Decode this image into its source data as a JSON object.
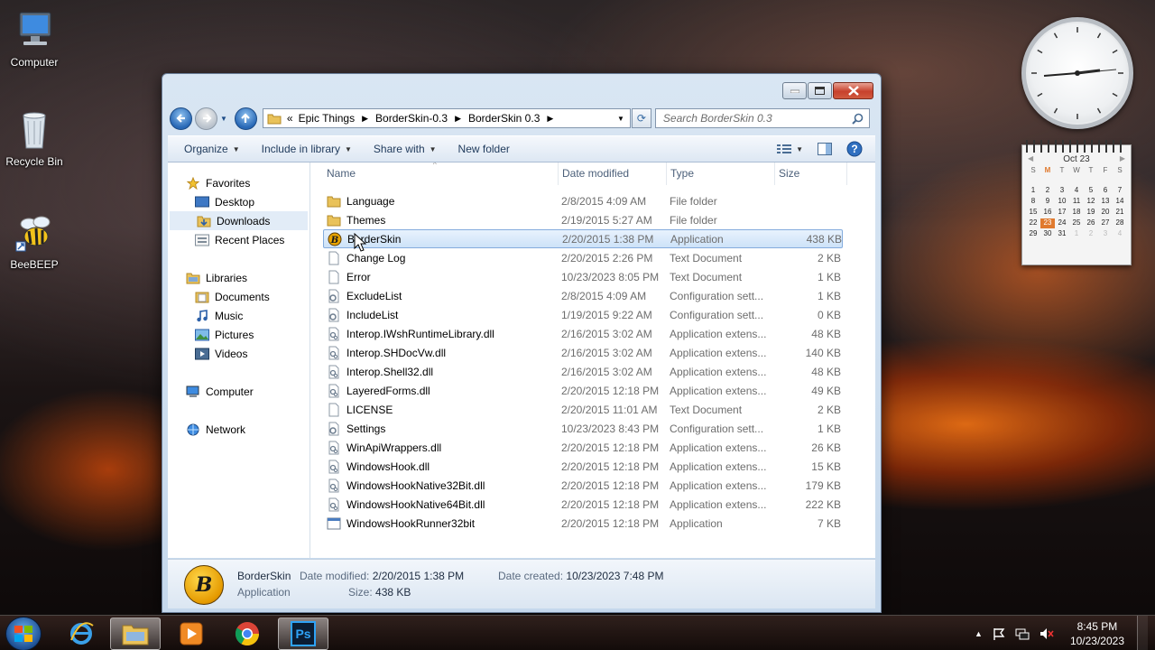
{
  "desktop": {
    "icons": [
      {
        "label": "Computer"
      },
      {
        "label": "Recycle Bin"
      },
      {
        "label": "BeeBEEP"
      }
    ]
  },
  "calendar": {
    "month": "Oct 23",
    "prev": "◀",
    "next": "▶",
    "day_headers": [
      "S",
      "M",
      "T",
      "W",
      "T",
      "F",
      "S"
    ],
    "days": [
      "",
      "",
      "",
      "",
      "",
      "",
      "",
      "1",
      "2",
      "3",
      "4",
      "5",
      "6",
      "7",
      "8",
      "9",
      "10",
      "11",
      "12",
      "13",
      "14",
      "15",
      "16",
      "17",
      "18",
      "19",
      "20",
      "21",
      "22",
      "23",
      "24",
      "25",
      "26",
      "27",
      "28",
      "29",
      "30",
      "31",
      "1",
      "2",
      "3",
      "4"
    ],
    "today": "23"
  },
  "window": {
    "nav": {
      "path": [
        "Epic Things",
        "BorderSkin-0.3",
        "BorderSkin 0.3"
      ],
      "overflow": "«",
      "search_placeholder": "Search BorderSkin 0.3"
    },
    "toolbar": {
      "organize": "Organize",
      "include_in_library": "Include in library",
      "share_with": "Share with",
      "new_folder": "New folder"
    },
    "navpane": {
      "favorites": "Favorites",
      "desktop": "Desktop",
      "downloads": "Downloads",
      "recent_places": "Recent Places",
      "libraries": "Libraries",
      "documents": "Documents",
      "music": "Music",
      "pictures": "Pictures",
      "videos": "Videos",
      "computer": "Computer",
      "network": "Network"
    },
    "columns": {
      "name": "Name",
      "date": "Date modified",
      "type": "Type",
      "size": "Size"
    },
    "files": [
      {
        "name": "Language",
        "date": "2/8/2015 4:09 AM",
        "type": "File folder",
        "size": "",
        "icon": "folder"
      },
      {
        "name": "Themes",
        "date": "2/19/2015 5:27 AM",
        "type": "File folder",
        "size": "",
        "icon": "folder"
      },
      {
        "name": "BorderSkin",
        "date": "2/20/2015 1:38 PM",
        "type": "Application",
        "size": "438 KB",
        "icon": "app-borderskin"
      },
      {
        "name": "Change Log",
        "date": "2/20/2015 2:26 PM",
        "type": "Text Document",
        "size": "2 KB",
        "icon": "text"
      },
      {
        "name": "Error",
        "date": "10/23/2023 8:05 PM",
        "type": "Text Document",
        "size": "1 KB",
        "icon": "text"
      },
      {
        "name": "ExcludeList",
        "date": "2/8/2015 4:09 AM",
        "type": "Configuration sett...",
        "size": "1 KB",
        "icon": "config"
      },
      {
        "name": "IncludeList",
        "date": "1/19/2015 9:22 AM",
        "type": "Configuration sett...",
        "size": "0 KB",
        "icon": "config"
      },
      {
        "name": "Interop.IWshRuntimeLibrary.dll",
        "date": "2/16/2015 3:02 AM",
        "type": "Application extens...",
        "size": "48 KB",
        "icon": "dll"
      },
      {
        "name": "Interop.SHDocVw.dll",
        "date": "2/16/2015 3:02 AM",
        "type": "Application extens...",
        "size": "140 KB",
        "icon": "dll"
      },
      {
        "name": "Interop.Shell32.dll",
        "date": "2/16/2015 3:02 AM",
        "type": "Application extens...",
        "size": "48 KB",
        "icon": "dll"
      },
      {
        "name": "LayeredForms.dll",
        "date": "2/20/2015 12:18 PM",
        "type": "Application extens...",
        "size": "49 KB",
        "icon": "dll"
      },
      {
        "name": "LICENSE",
        "date": "2/20/2015 11:01 AM",
        "type": "Text Document",
        "size": "2 KB",
        "icon": "text"
      },
      {
        "name": "Settings",
        "date": "10/23/2023 8:43 PM",
        "type": "Configuration sett...",
        "size": "1 KB",
        "icon": "config"
      },
      {
        "name": "WinApiWrappers.dll",
        "date": "2/20/2015 12:18 PM",
        "type": "Application extens...",
        "size": "26 KB",
        "icon": "dll"
      },
      {
        "name": "WindowsHook.dll",
        "date": "2/20/2015 12:18 PM",
        "type": "Application extens...",
        "size": "15 KB",
        "icon": "dll"
      },
      {
        "name": "WindowsHookNative32Bit.dll",
        "date": "2/20/2015 12:18 PM",
        "type": "Application extens...",
        "size": "179 KB",
        "icon": "dll"
      },
      {
        "name": "WindowsHookNative64Bit.dll",
        "date": "2/20/2015 12:18 PM",
        "type": "Application extens...",
        "size": "222 KB",
        "icon": "dll"
      },
      {
        "name": "WindowsHookRunner32bit",
        "date": "2/20/2015 12:18 PM",
        "type": "Application",
        "size": "7 KB",
        "icon": "app-generic"
      }
    ],
    "selected_index": 2,
    "details": {
      "logo_letter": "B",
      "name": "BorderSkin",
      "type": "Application",
      "date_modified_label": "Date modified:",
      "date_modified": "2/20/2015 1:38 PM",
      "size_label": "Size:",
      "size": "438 KB",
      "date_created_label": "Date created:",
      "date_created": "10/23/2023 7:48 PM"
    }
  },
  "taskbar": {
    "time": "8:45 PM",
    "date": "10/23/2023",
    "apps": [
      "internet-explorer",
      "windows-explorer",
      "media-player",
      "chrome",
      "photoshop"
    ],
    "photoshop_label": "Ps"
  },
  "colors": {
    "selection": "#cde2f8",
    "close_button": "#c8412c",
    "link_text": "#1e395b",
    "calendar_today": "#e07a2f"
  }
}
